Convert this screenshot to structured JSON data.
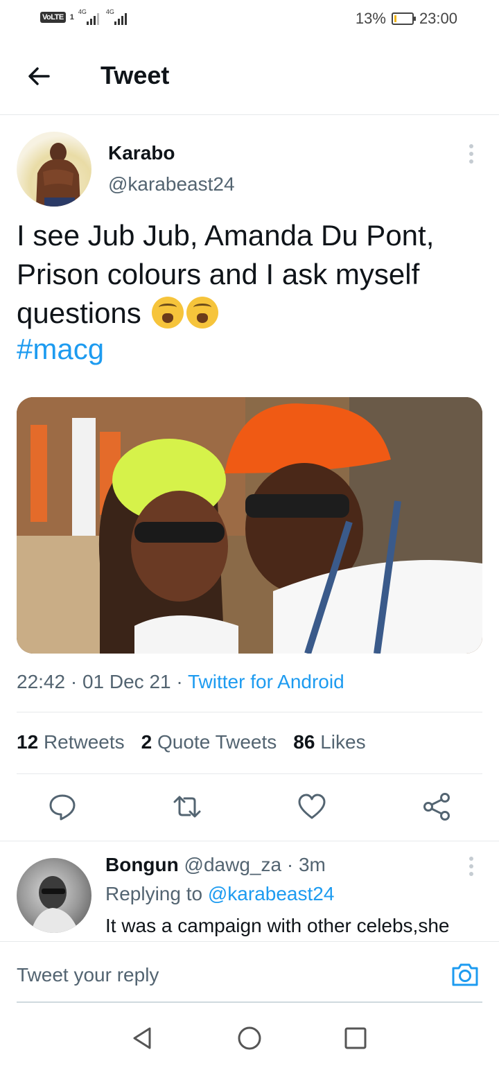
{
  "status_bar": {
    "volte": "VoLTE",
    "sim": "1",
    "signal_1": "4G",
    "signal_2": "4G",
    "battery_percent": "13%",
    "battery_level": 0.13,
    "time": "23:00"
  },
  "header": {
    "title": "Tweet",
    "back_icon": "arrow-left-icon"
  },
  "tweet": {
    "author_name": "Karabo",
    "author_handle": "@karabeast24",
    "text_lines": [
      "I see Jub Jub, Amanda Du Pont,",
      "Prison colours and I ask myself",
      "questions"
    ],
    "emojis": [
      "loudly-crying-face",
      "loudly-crying-face"
    ],
    "hashtag": "#macg",
    "time": "22:42",
    "dot": "·",
    "date": "01 Dec 21",
    "source": "Twitter for Android",
    "stats": {
      "retweets_count": "12",
      "retweets_label": "Retweets",
      "quotes_count": "2",
      "quotes_label": "Quote Tweets",
      "likes_count": "86",
      "likes_label": "Likes"
    },
    "actions": [
      "reply-icon",
      "retweet-icon",
      "like-icon",
      "share-icon"
    ]
  },
  "reply": {
    "name": "Bongun",
    "handle": "@dawg_za",
    "dot": "·",
    "age": "3m",
    "replying_prefix": "Replying to",
    "replying_to": "@karabeast24",
    "text": "It was a campaign with other celebs,she"
  },
  "compose": {
    "placeholder": "Tweet your reply",
    "camera_icon": "camera-icon"
  },
  "nav": [
    "back-triangle-icon",
    "home-circle-icon",
    "recents-square-icon"
  ],
  "colors": {
    "accent": "#1d9bf0",
    "secondary_text": "#536471",
    "primary_text": "#0f1419",
    "divider": "#e6e9eb"
  }
}
